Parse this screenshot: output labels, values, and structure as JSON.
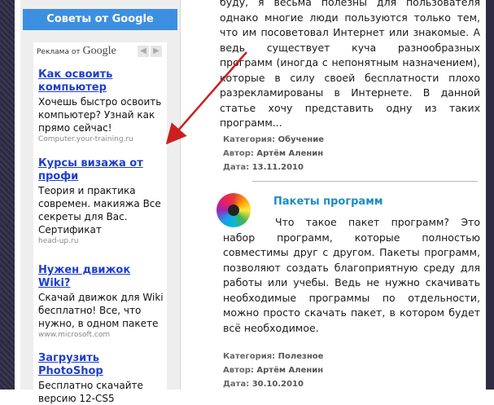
{
  "sidebar": {
    "header": "Советы от Google",
    "ads_by_label": "Реклама от",
    "google_logo": "Google",
    "nav_prev": "◀",
    "nav_next": "▶",
    "ads": [
      {
        "title": "Как освоить компьютер",
        "text": "Хочешь быстро освоить компьютер? Узнай как прямо сейчас!",
        "url": "Computer.your-training.ru"
      },
      {
        "title": "Курсы визажа от профи",
        "text": "Теория и практика современ. макияжа Все секреты для Вас. Сертификат",
        "url": "head-up.ru"
      },
      {
        "title": "Нужен движок Wiki?",
        "text": "Скачай движок для Wiki бесплатно! Все, что нужно, в одном пакете",
        "url": "www.microsoft.com"
      },
      {
        "title": "Загрузить PhotoShop",
        "text": "Бесплатно скачайте версию 12-CS5",
        "url": ""
      }
    ]
  },
  "post1": {
    "text_top": "буду, я весьма полезны для пользователя однако многие люди пользуются только тем, что им посоветовал Интернет или знакомые. А ведь существует куча разнообразных программ (иногда с непонятным назначением), которые в силу своей бесплатности плохо разрекламированы в Интернете. В данной статье хочу представить одну из таких программ...",
    "category_label": "Категория:",
    "category": "Обучение",
    "author_label": "Автор:",
    "author": "Артём Аленин",
    "date_label": "Дата:",
    "date": "13.11.2010"
  },
  "post2": {
    "title": "Пакеты программ",
    "text": "Что такое пакет программ? Это набор программ, которые полностью совместимы друг с другом. Пакеты программ, позволяют создать благоприятную среду для работы или учебы. Ведь не нужно скачивать необходимые программы по отдельности, можно просто скачать пакет, в котором будет всё необходимое.",
    "category_label": "Категория:",
    "category": "Полезное",
    "author_label": "Автор:",
    "author": "Артём Аленин",
    "date_label": "Дата:",
    "date": "30.10.2010"
  },
  "colors": {
    "header_bg": "#3d8fe0",
    "ad_link": "#1f3fcc",
    "post_title": "#1a8ec0",
    "arrow": "#cc1f1f"
  }
}
